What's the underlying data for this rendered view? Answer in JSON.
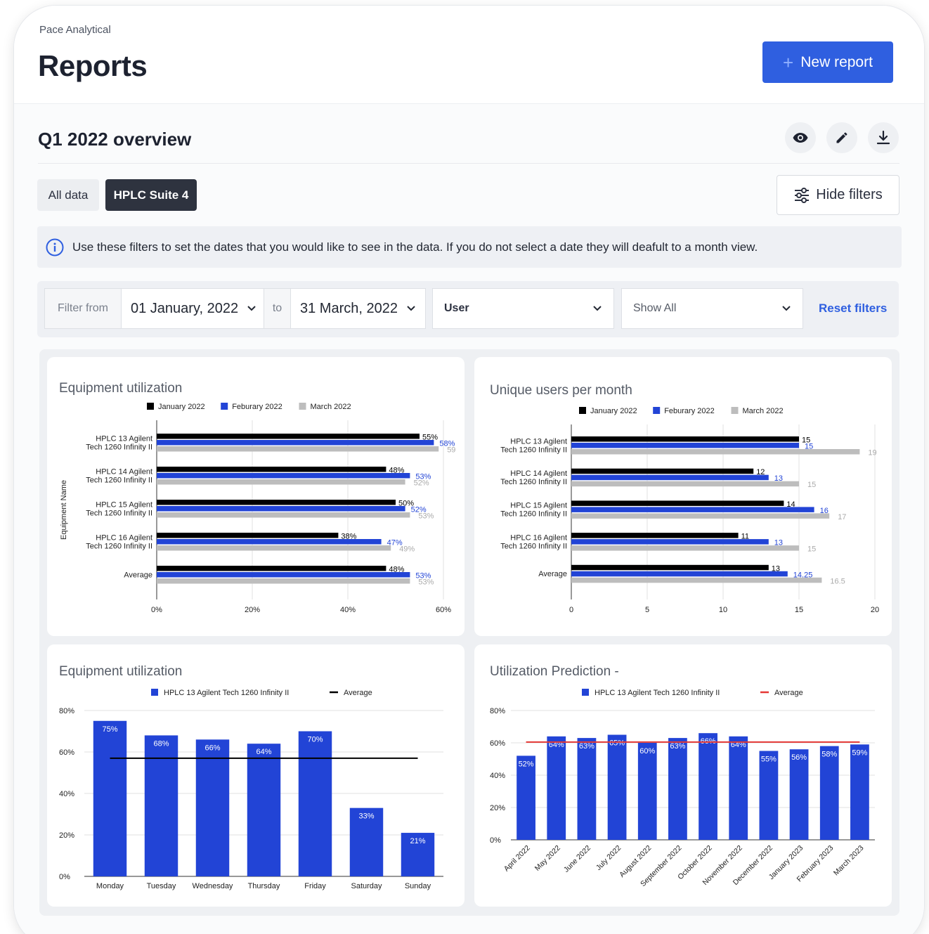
{
  "header": {
    "org": "Pace Analytical",
    "title": "Reports",
    "new_report_label": "New report"
  },
  "report": {
    "title": "Q1 2022 overview"
  },
  "tabs": [
    {
      "label": "All data"
    },
    {
      "label": "HPLC Suite 4"
    }
  ],
  "hide_filters_label": "Hide filters",
  "info": {
    "text": "Use these filters to set the dates that you would like to see in the data. If you do not select a date they will deafult to a month view."
  },
  "filters": {
    "from_label": "Filter from",
    "from_value": "01 January, 2022",
    "to_label": "to",
    "to_value": "31 March, 2022",
    "user_value": "User",
    "show_value": "Show All",
    "reset_label": "Reset filters"
  },
  "icons": [
    "plus-icon",
    "eye-icon",
    "pencil-icon",
    "download-icon",
    "sliders-icon",
    "info-icon",
    "chevron-down-icon"
  ],
  "colors": {
    "accent": "#2f5fe0",
    "series_jan": "#000000",
    "series_feb": "#2244d6",
    "series_mar": "#bdbdbd",
    "average_line_red": "#e53935"
  },
  "chart_data": [
    {
      "type": "bar",
      "orientation": "horizontal",
      "title": "Equipment utilization",
      "ylabel": "Equipment Name",
      "categories": [
        "HPLC 13 Agilent Tech 1260 Infinity II",
        "HPLC 14 Agilent Tech 1260 Infinity II",
        "HPLC 15 Agilent Tech 1260 Infinity II",
        "HPLC 16 Agilent Tech 1260 Infinity II",
        "Average"
      ],
      "series": [
        {
          "name": "January 2022",
          "values": [
            55,
            48,
            50,
            38,
            48
          ],
          "labels": [
            "55%",
            "48%",
            "50%",
            "38%",
            "48%"
          ]
        },
        {
          "name": "Feburary 2022",
          "values": [
            58,
            53,
            52,
            47,
            53
          ],
          "labels": [
            "58%",
            "53%",
            "52%",
            "47%",
            "53%"
          ]
        },
        {
          "name": "March 2022",
          "values": [
            59,
            52,
            53,
            49,
            53
          ],
          "labels": [
            "59",
            "52%",
            "53%",
            "49%",
            "53%"
          ]
        }
      ],
      "xlim": [
        0,
        60
      ],
      "xticks": [
        "0%",
        "20%",
        "40%",
        "60%"
      ],
      "legend": "top"
    },
    {
      "type": "bar",
      "orientation": "horizontal",
      "title": "Unique users per month",
      "categories": [
        "HPLC 13 Agilent Tech 1260 Infinity II",
        "HPLC 14 Agilent Tech 1260 Infinity II",
        "HPLC 15 Agilent Tech 1260 Infinity II",
        "HPLC 16 Agilent Tech 1260 Infinity II",
        "Average"
      ],
      "series": [
        {
          "name": "January 2022",
          "values": [
            15,
            12,
            14,
            11,
            13
          ],
          "labels": [
            "15",
            "12",
            "14",
            "11",
            "13"
          ]
        },
        {
          "name": "Feburary 2022",
          "values": [
            15,
            13,
            16,
            13,
            14.25
          ],
          "labels": [
            "15",
            "13",
            "16",
            "13",
            "14.25"
          ]
        },
        {
          "name": "March 2022",
          "values": [
            19,
            15,
            17,
            15,
            16.5
          ],
          "labels": [
            "19",
            "15",
            "17",
            "15",
            "16.5"
          ]
        }
      ],
      "xlim": [
        0,
        20
      ],
      "xticks": [
        "0",
        "5",
        "10",
        "15",
        "20"
      ],
      "legend": "top"
    },
    {
      "type": "bar",
      "title": "Equipment utilization",
      "categories": [
        "Monday",
        "Tuesday",
        "Wednesday",
        "Thursday",
        "Friday",
        "Saturday",
        "Sunday"
      ],
      "series": [
        {
          "name": "HPLC 13 Agilent Tech 1260 Infinity II",
          "values": [
            75,
            68,
            66,
            64,
            70,
            33,
            21
          ],
          "labels": [
            "75%",
            "68%",
            "66%",
            "64%",
            "70%",
            "33%",
            "21%"
          ]
        },
        {
          "name": "Average",
          "type": "line",
          "value": 57
        }
      ],
      "ylim": [
        0,
        80
      ],
      "yticks": [
        "0%",
        "20%",
        "40%",
        "60%",
        "80%"
      ],
      "legend": "top"
    },
    {
      "type": "bar",
      "title": "Utilization Prediction -",
      "categories": [
        "April 2022",
        "May 2022",
        "June 2022",
        "July 2022",
        "August 2022",
        "September 2022",
        "October 2022",
        "November 2022",
        "December 2022",
        "January 2023",
        "February 2023",
        "March 2023"
      ],
      "series": [
        {
          "name": "HPLC 13 Agilent Tech 1260 Infinity II",
          "values": [
            52,
            64,
            63,
            65,
            60,
            63,
            66,
            64,
            55,
            56,
            58,
            59
          ],
          "labels": [
            "52%",
            "64%",
            "63%",
            "65%",
            "60%",
            "63%",
            "66%",
            "64%",
            "55%",
            "56%",
            "58%",
            "59%"
          ]
        },
        {
          "name": "Average",
          "type": "line",
          "value": 60.5
        }
      ],
      "ylim": [
        0,
        80
      ],
      "yticks": [
        "0%",
        "20%",
        "40%",
        "60%",
        "80%"
      ],
      "legend": "top"
    }
  ]
}
